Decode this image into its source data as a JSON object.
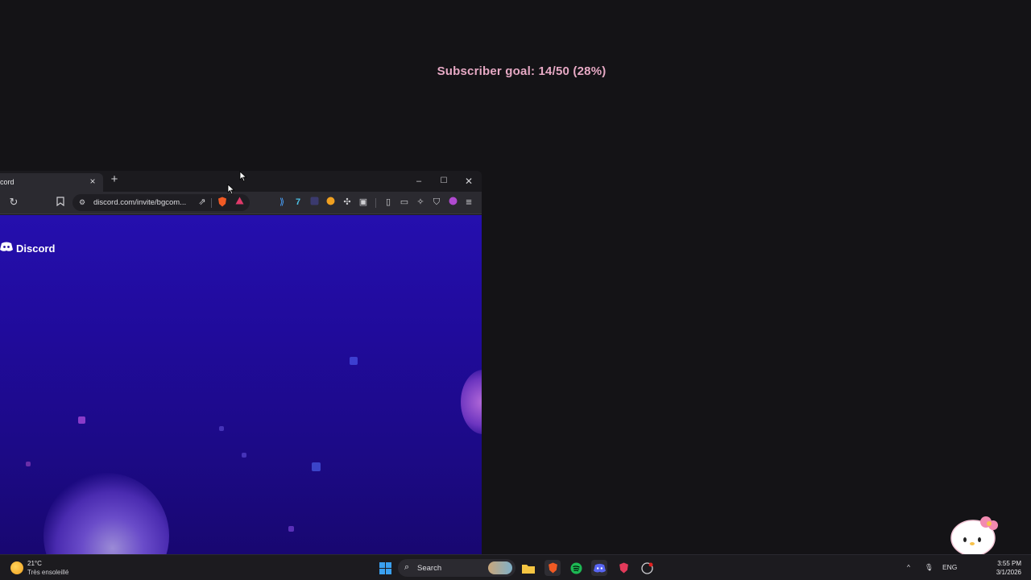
{
  "overlay": {
    "goal_text": "Subscriber goal: 14/50 (28%)"
  },
  "browser": {
    "tab_title": "cord",
    "url": "discord.com/invite/bgcom...",
    "brand_name": "Discord"
  },
  "taskbar": {
    "temperature": "21°C",
    "weather_condition": "Très ensoleillé",
    "search_placeholder": "Search",
    "language": "ENG",
    "time": "3:55 PM",
    "date": "3/1/2026"
  },
  "colors": {
    "background": "#141316",
    "goal_text": "#e6a9c4",
    "discord_content": "#200b9b"
  }
}
